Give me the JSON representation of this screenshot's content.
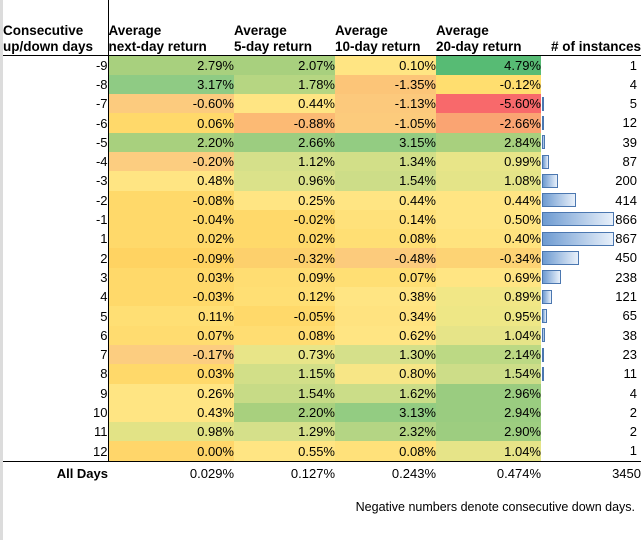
{
  "header": {
    "label_line1": "Consecutive",
    "label_line2": "up/down days",
    "col1_line1": "Average",
    "col1_line2": "next-day return",
    "col2_line1": "Average",
    "col2_line2": "5-day return",
    "col3_line1": "Average",
    "col3_line2": "10-day return",
    "col4_line1": "Average",
    "col4_line2": "20-day return",
    "col5": "# of instances"
  },
  "footnote": "Negative numbers denote consecutive down days.",
  "totals": {
    "label": "All Days",
    "next_day": "0.029%",
    "day5": "0.127%",
    "day10": "0.243%",
    "day20": "0.474%",
    "instances": "3450"
  },
  "colors": {
    "green_dark": "#57bb74",
    "green_mid": "#8fcb84",
    "green_light": "#a8d07e",
    "yellow_green": "#d5e08a",
    "yellow": "#ffe583",
    "yellow_deep": "#ffd966",
    "orange_light": "#fccb7e",
    "orange": "#faa472",
    "red": "#f8696b",
    "bar_fill_dark": "#6e9bd1",
    "bar_fill_light": "#e8f0fa",
    "bar_border": "#4b77b0"
  },
  "chart_data": {
    "type": "heatmap",
    "title": "",
    "grid": true,
    "legend": "none",
    "row_label_header": "Consecutive up/down days",
    "categories": [
      "-9",
      "-8",
      "-7",
      "-6",
      "-5",
      "-4",
      "-3",
      "-2",
      "-1",
      "1",
      "2",
      "3",
      "4",
      "5",
      "6",
      "7",
      "8",
      "9",
      "10",
      "11",
      "12"
    ],
    "columns": [
      "Average next-day return",
      "Average 5-day return",
      "Average 10-day return",
      "Average 20-day return",
      "# of instances"
    ],
    "series": [
      {
        "name": "Average next-day return",
        "values": [
          2.79,
          3.17,
          -0.6,
          0.06,
          2.2,
          -0.2,
          0.48,
          -0.08,
          -0.04,
          0.02,
          -0.09,
          0.03,
          -0.03,
          0.11,
          0.07,
          -0.17,
          0.03,
          0.26,
          0.43,
          0.98,
          0.0
        ]
      },
      {
        "name": "Average 5-day return",
        "values": [
          2.07,
          1.78,
          0.44,
          -0.88,
          2.66,
          1.12,
          0.96,
          0.25,
          -0.02,
          0.02,
          -0.32,
          0.09,
          0.12,
          -0.05,
          0.08,
          0.73,
          1.15,
          1.54,
          2.2,
          1.29,
          0.55
        ]
      },
      {
        "name": "Average 10-day return",
        "values": [
          0.1,
          -1.35,
          -1.13,
          -1.05,
          3.15,
          1.34,
          1.54,
          0.44,
          0.14,
          0.08,
          -0.48,
          0.07,
          0.38,
          0.34,
          0.62,
          1.3,
          0.8,
          1.62,
          3.13,
          2.32,
          0.08
        ]
      },
      {
        "name": "Average 20-day return",
        "values": [
          4.79,
          -0.12,
          -5.6,
          -2.66,
          2.84,
          0.99,
          1.08,
          0.44,
          0.5,
          0.4,
          -0.34,
          0.69,
          0.89,
          0.95,
          1.04,
          2.14,
          1.54,
          2.96,
          2.94,
          2.9,
          1.04
        ]
      },
      {
        "name": "# of instances",
        "values": [
          1,
          4,
          5,
          12,
          39,
          87,
          200,
          414,
          866,
          867,
          450,
          238,
          121,
          65,
          38,
          23,
          11,
          4,
          2,
          2,
          1
        ]
      }
    ]
  },
  "rows": [
    {
      "label": "-9",
      "d1": {
        "t": "2.79%",
        "c": "#a8d07e"
      },
      "d5": {
        "t": "2.07%",
        "c": "#a8d07e"
      },
      "d10": {
        "t": "0.10%",
        "c": "#ffe583"
      },
      "d20": {
        "t": "4.79%",
        "c": "#57bb74"
      },
      "inst": "1",
      "bar": 0
    },
    {
      "label": "-8",
      "d1": {
        "t": "3.17%",
        "c": "#8fcb84"
      },
      "d5": {
        "t": "1.78%",
        "c": "#b6d682"
      },
      "d10": {
        "t": "-1.35%",
        "c": "#fcc578"
      },
      "d20": {
        "t": "-0.12%",
        "c": "#ffde6f"
      },
      "inst": "4",
      "bar": 0
    },
    {
      "label": "-7",
      "d1": {
        "t": "-0.60%",
        "c": "#fccb7e"
      },
      "d5": {
        "t": "0.44%",
        "c": "#ffe583"
      },
      "d10": {
        "t": "-1.13%",
        "c": "#fcc97c"
      },
      "d20": {
        "t": "-5.60%",
        "c": "#f8696b"
      },
      "inst": "5",
      "bar": 1
    },
    {
      "label": "-6",
      "d1": {
        "t": "0.06%",
        "c": "#ffd96a"
      },
      "d5": {
        "t": "-0.88%",
        "c": "#fcba74"
      },
      "d10": {
        "t": "-1.05%",
        "c": "#fccb7c"
      },
      "d20": {
        "t": "-2.66%",
        "c": "#faa472"
      },
      "inst": "12",
      "bar": 1.2
    },
    {
      "label": "-5",
      "d1": {
        "t": "2.20%",
        "c": "#a8d07e"
      },
      "d5": {
        "t": "2.66%",
        "c": "#9ccd80"
      },
      "d10": {
        "t": "3.15%",
        "c": "#93cc82"
      },
      "d20": {
        "t": "2.84%",
        "c": "#a8d07e"
      },
      "inst": "39",
      "bar": 4
    },
    {
      "label": "-4",
      "d1": {
        "t": "-0.20%",
        "c": "#fccd80"
      },
      "d5": {
        "t": "1.12%",
        "c": "#d5e08a"
      },
      "d10": {
        "t": "1.34%",
        "c": "#d2df88"
      },
      "d20": {
        "t": "0.99%",
        "c": "#e8e588"
      },
      "inst": "87",
      "bar": 9
    },
    {
      "label": "-3",
      "d1": {
        "t": "0.48%",
        "c": "#ffe583"
      },
      "d5": {
        "t": "0.96%",
        "c": "#dbe28a"
      },
      "d10": {
        "t": "1.54%",
        "c": "#cddd88"
      },
      "d20": {
        "t": "1.08%",
        "c": "#e4e488"
      },
      "inst": "200",
      "bar": 21
    },
    {
      "label": "-2",
      "d1": {
        "t": "-0.08%",
        "c": "#ffd96a"
      },
      "d5": {
        "t": "0.25%",
        "c": "#ffe583"
      },
      "d10": {
        "t": "0.44%",
        "c": "#ffe583"
      },
      "d20": {
        "t": "0.44%",
        "c": "#ffe583"
      },
      "inst": "414",
      "bar": 44
    },
    {
      "label": "-1",
      "d1": {
        "t": "-0.04%",
        "c": "#ffd96a"
      },
      "d5": {
        "t": "-0.02%",
        "c": "#ffd96a"
      },
      "d10": {
        "t": "0.14%",
        "c": "#ffe17a"
      },
      "d20": {
        "t": "0.50%",
        "c": "#ffe583"
      },
      "inst": "866",
      "bar": 93
    },
    {
      "label": "1",
      "d1": {
        "t": "0.02%",
        "c": "#ffd96a"
      },
      "d5": {
        "t": "0.02%",
        "c": "#ffd96a"
      },
      "d10": {
        "t": "0.08%",
        "c": "#ffdf74"
      },
      "d20": {
        "t": "0.40%",
        "c": "#ffe37e"
      },
      "inst": "867",
      "bar": 93.5
    },
    {
      "label": "2",
      "d1": {
        "t": "-0.09%",
        "c": "#ffd362"
      },
      "d5": {
        "t": "-0.32%",
        "c": "#fdd06c"
      },
      "d10": {
        "t": "-0.48%",
        "c": "#fccb7c"
      },
      "d20": {
        "t": "-0.34%",
        "c": "#fdd374"
      },
      "inst": "450",
      "bar": 48
    },
    {
      "label": "3",
      "d1": {
        "t": "0.03%",
        "c": "#ffd96a"
      },
      "d5": {
        "t": "0.09%",
        "c": "#ffdd72"
      },
      "d10": {
        "t": "0.07%",
        "c": "#ffdf74"
      },
      "d20": {
        "t": "0.69%",
        "c": "#ffe583"
      },
      "inst": "238",
      "bar": 25
    },
    {
      "label": "4",
      "d1": {
        "t": "-0.03%",
        "c": "#ffd96a"
      },
      "d5": {
        "t": "0.12%",
        "c": "#ffdf74"
      },
      "d10": {
        "t": "0.38%",
        "c": "#ffe583"
      },
      "d20": {
        "t": "0.89%",
        "c": "#f1e786"
      },
      "inst": "121",
      "bar": 13
    },
    {
      "label": "5",
      "d1": {
        "t": "0.11%",
        "c": "#ffdf74"
      },
      "d5": {
        "t": "-0.05%",
        "c": "#ffd96a"
      },
      "d10": {
        "t": "0.34%",
        "c": "#ffe380"
      },
      "d20": {
        "t": "0.95%",
        "c": "#eee786"
      },
      "inst": "65",
      "bar": 7
    },
    {
      "label": "6",
      "d1": {
        "t": "0.07%",
        "c": "#ffdc70"
      },
      "d5": {
        "t": "0.08%",
        "c": "#ffdd72"
      },
      "d10": {
        "t": "0.62%",
        "c": "#ffe583"
      },
      "d20": {
        "t": "1.04%",
        "c": "#e6e488"
      },
      "inst": "38",
      "bar": 4
    },
    {
      "label": "7",
      "d1": {
        "t": "-0.17%",
        "c": "#fccd80"
      },
      "d5": {
        "t": "0.73%",
        "c": "#e8e588"
      },
      "d10": {
        "t": "1.30%",
        "c": "#d5e08a"
      },
      "d20": {
        "t": "2.14%",
        "c": "#bcd984"
      },
      "inst": "23",
      "bar": 2.5
    },
    {
      "label": "8",
      "d1": {
        "t": "0.03%",
        "c": "#ffd96a"
      },
      "d5": {
        "t": "1.15%",
        "c": "#d2df88"
      },
      "d10": {
        "t": "0.80%",
        "c": "#f7e686"
      },
      "d20": {
        "t": "1.54%",
        "c": "#cddd88"
      },
      "inst": "11",
      "bar": 1.2
    },
    {
      "label": "9",
      "d1": {
        "t": "0.26%",
        "c": "#ffe583"
      },
      "d5": {
        "t": "1.54%",
        "c": "#c7db86"
      },
      "d10": {
        "t": "1.62%",
        "c": "#cbdd88"
      },
      "d20": {
        "t": "2.96%",
        "c": "#9acc80"
      },
      "inst": "4",
      "bar": 0
    },
    {
      "label": "10",
      "d1": {
        "t": "0.43%",
        "c": "#ffe583"
      },
      "d5": {
        "t": "2.20%",
        "c": "#a8d07e"
      },
      "d10": {
        "t": "3.13%",
        "c": "#93cc82"
      },
      "d20": {
        "t": "2.94%",
        "c": "#9acc80"
      },
      "inst": "2",
      "bar": 0
    },
    {
      "label": "11",
      "d1": {
        "t": "0.98%",
        "c": "#e2e386"
      },
      "d5": {
        "t": "1.29%",
        "c": "#d5e08a"
      },
      "d10": {
        "t": "2.32%",
        "c": "#b4d584"
      },
      "d20": {
        "t": "2.90%",
        "c": "#9dcd80"
      },
      "inst": "2",
      "bar": 0
    },
    {
      "label": "12",
      "d1": {
        "t": "0.00%",
        "c": "#ffd66a"
      },
      "d5": {
        "t": "0.55%",
        "c": "#ffe583"
      },
      "d10": {
        "t": "0.08%",
        "c": "#ffe17a"
      },
      "d20": {
        "t": "1.04%",
        "c": "#e6e488"
      },
      "inst": "1",
      "bar": 0
    }
  ]
}
